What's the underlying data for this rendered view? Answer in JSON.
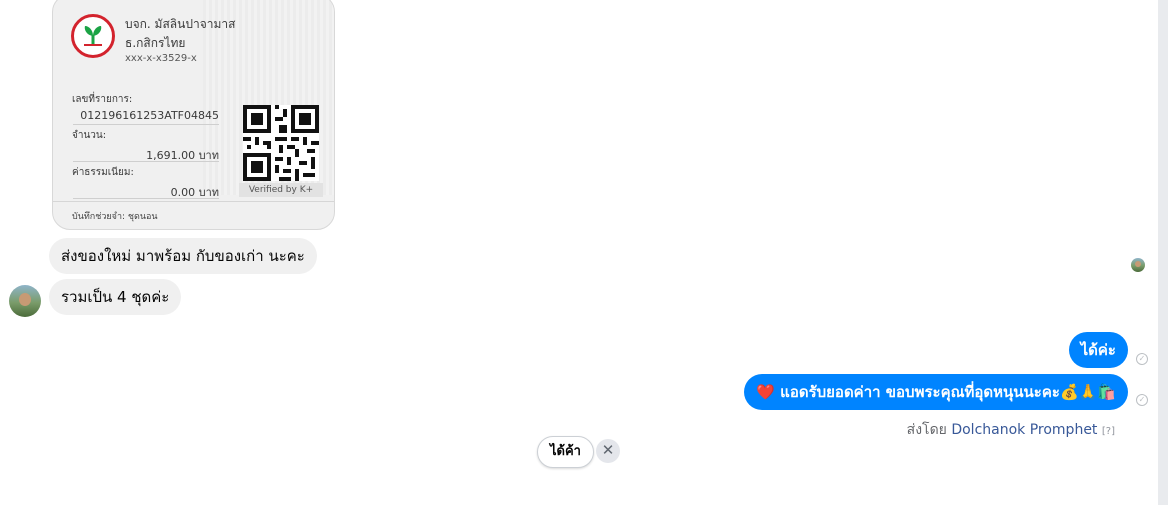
{
  "receipt": {
    "company": "บจก. มัสลินปาจามาส",
    "bank": "ธ.กสิกรไทย",
    "account": "xxx-x-x3529-x",
    "ref_label": "เลขที่รายการ:",
    "ref_value": "012196161253ATF04845",
    "amount_label": "จำนวน:",
    "amount_value": "1,691.00 บาท",
    "fee_label": "ค่าธรรมเนียม:",
    "fee_value": "0.00 บาท",
    "verified": "Verified by K+",
    "memo": "บันทึกช่วยจำ: ชุดนอน",
    "logo_color": "#d3232d",
    "logo_leaf_color": "#1ba345"
  },
  "incoming": [
    {
      "text": "ส่งของใหม่ มาพร้อม กับของเก่า นะคะ"
    },
    {
      "text": "รวมเป็น 4 ชุดค่ะ"
    }
  ],
  "outgoing": [
    {
      "text": "ได้ค่ะ"
    },
    {
      "text": "❤️ แอดรับยอดค่าา ขอบพระคุณที่อุดหนุนนะคะ💰🙏🛍️"
    }
  ],
  "sent_by": {
    "prefix": "ส่งโดย ",
    "name": "Dolchanok Promphet",
    "help": "[?]"
  },
  "quick_reply": {
    "label": "ได้ค้า",
    "dismiss": "✕"
  },
  "colors": {
    "outgoing_bubble": "#0084ff",
    "incoming_bubble": "#f0f0f0"
  }
}
